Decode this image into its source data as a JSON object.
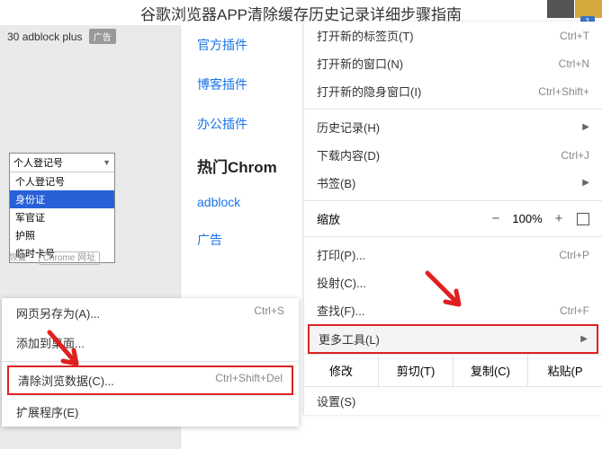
{
  "title": "谷歌浏览器APP清除缓存历史记录详细步骤指南",
  "badge": "1",
  "left": {
    "row1_prefix": "30",
    "row1_text": "adblock plus",
    "ad_tag": "广告",
    "dropdown": {
      "head": "个人登记号",
      "items": [
        "个人登记号",
        "身份证",
        "军官证",
        "护照",
        "临时卡号"
      ],
      "selected_index": 1
    },
    "footer_restore": "恢复",
    "footer_chrome": "Chrome 网址"
  },
  "mid": {
    "links": [
      "官方插件",
      "博客插件",
      "办公插件"
    ],
    "heading": "热门Chrom",
    "links2": [
      "adblock",
      "广告"
    ]
  },
  "menu": {
    "new_tab": "打开新的标签页(T)",
    "new_tab_sc": "Ctrl+T",
    "new_window": "打开新的窗口(N)",
    "new_window_sc": "Ctrl+N",
    "incognito": "打开新的隐身窗口(I)",
    "incognito_sc": "Ctrl+Shift+",
    "history": "历史记录(H)",
    "downloads": "下载内容(D)",
    "downloads_sc": "Ctrl+J",
    "bookmarks": "书签(B)",
    "zoom_label": "缩放",
    "zoom_minus": "−",
    "zoom_val": "100%",
    "zoom_plus": "+",
    "print": "打印(P)...",
    "print_sc": "Ctrl+P",
    "cast": "投射(C)...",
    "find": "查找(F)...",
    "find_sc": "Ctrl+F",
    "more_tools": "更多工具(L)",
    "edit_label": "修改",
    "cut": "剪切(T)",
    "copy": "复制(C)",
    "paste": "粘贴(P",
    "settings": "设置(S)"
  },
  "submenu": {
    "save_as": "网页另存为(A)...",
    "save_as_sc": "Ctrl+S",
    "add_desktop": "添加到桌面...",
    "clear_data": "清除浏览数据(C)...",
    "clear_data_sc": "Ctrl+Shift+Del",
    "extensions": "扩展程序(E)"
  }
}
